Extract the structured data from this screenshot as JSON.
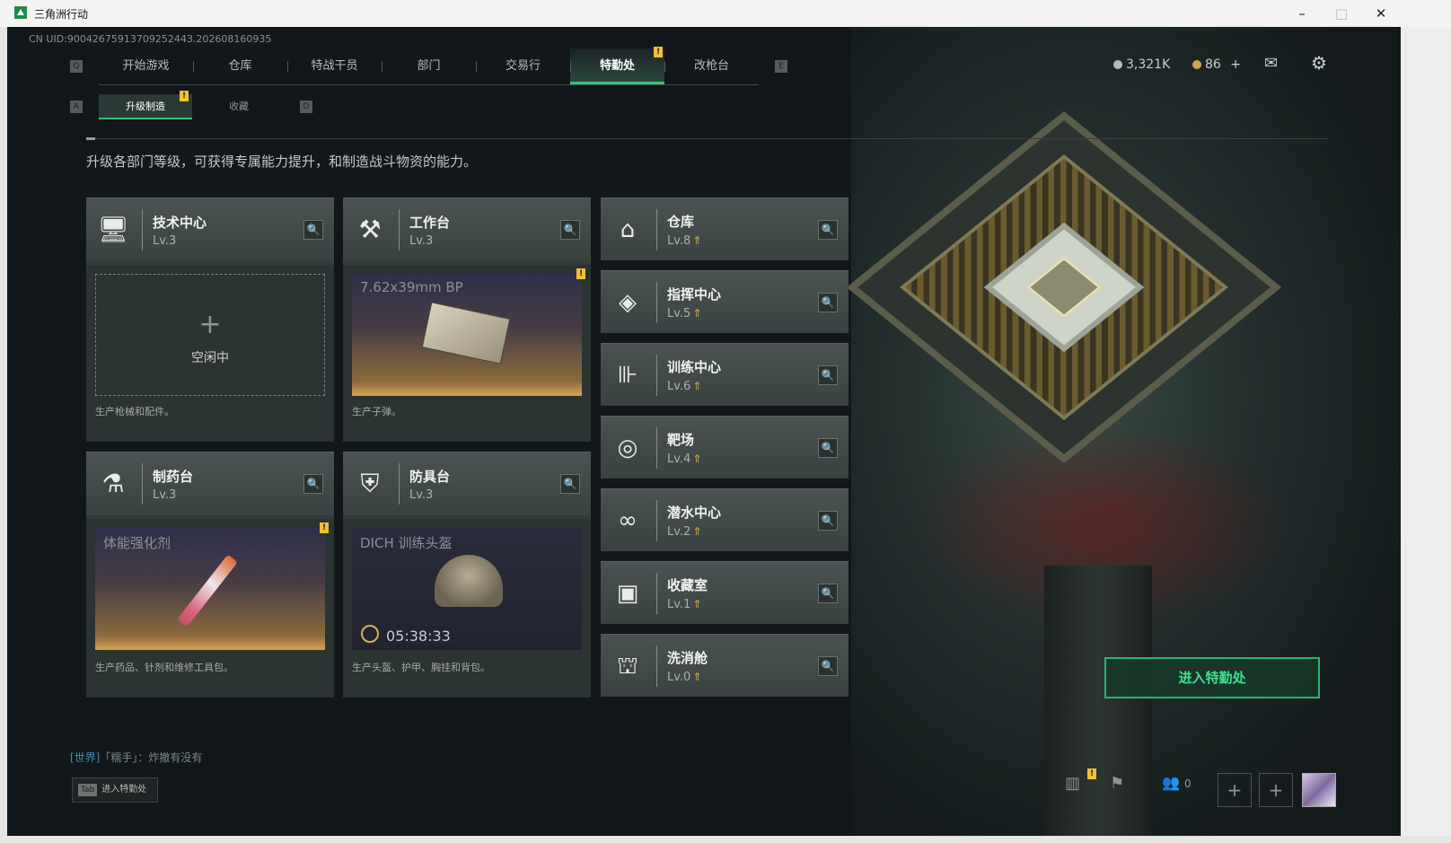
{
  "window": {
    "title": "三角洲行动",
    "controls": {
      "minimize": "–",
      "maximize": "□",
      "close": "✕"
    }
  },
  "uid": "CN UID:9004267591370925244З.202608160935",
  "nav": {
    "key_left": "Q",
    "key_right": "E",
    "tabs": [
      {
        "label": "开始游戏"
      },
      {
        "label": "仓库"
      },
      {
        "label": "特战干员"
      },
      {
        "label": "部门"
      },
      {
        "label": "交易行"
      },
      {
        "label": "特勤处",
        "active": true,
        "badge": "!"
      },
      {
        "label": "改枪台"
      }
    ]
  },
  "currency": {
    "value1": "3,321K",
    "value2": "86",
    "add": "+"
  },
  "icons": {
    "mail": "mail-icon",
    "settings": "gear-icon"
  },
  "subnav": {
    "key_left": "A",
    "key_right": "D",
    "tabs": [
      {
        "label": "升级制造",
        "active": true,
        "badge": "!"
      },
      {
        "label": "收藏"
      }
    ]
  },
  "intro": "升级各部门等级，可获得专属能力提升，和制造战斗物资的能力。",
  "stations": {
    "tech": {
      "name": "技术中心",
      "lv": "Lv.3",
      "slot_label": "空闲中",
      "slot_plus": "+",
      "desc": "生产枪械和配件。"
    },
    "workbench": {
      "name": "工作台",
      "lv": "Lv.3",
      "item": "7.62x39mm BP",
      "badge": "!",
      "desc": "生产子弹。"
    },
    "pharmacy": {
      "name": "制药台",
      "lv": "Lv.3",
      "item": "体能强化剂",
      "badge": "!",
      "desc": "生产药品、针剂和维修工具包。"
    },
    "armor": {
      "name": "防具台",
      "lv": "Lv.3",
      "item": "DICH 训练头盔",
      "timer": "05:38:33",
      "desc": "生产头盔、护甲、胸挂和背包。"
    }
  },
  "facilities": [
    {
      "name": "仓库",
      "lv": "Lv.8",
      "icon": "warehouse-icon"
    },
    {
      "name": "指挥中心",
      "lv": "Lv.5",
      "icon": "command-icon"
    },
    {
      "name": "训练中心",
      "lv": "Lv.6",
      "icon": "dumbbell-icon"
    },
    {
      "name": "靶场",
      "lv": "Lv.4",
      "icon": "target-icon"
    },
    {
      "name": "潜水中心",
      "lv": "Lv.2",
      "icon": "diving-mask-icon"
    },
    {
      "name": "收藏室",
      "lv": "Lv.1",
      "icon": "collection-icon"
    },
    {
      "name": "洗消舱",
      "lv": "Lv.0",
      "icon": "decontamination-icon"
    }
  ],
  "enter_button": "进入特勤处",
  "chat": {
    "channel": "[世界]",
    "user": "「糯手」",
    "message": "：炸撤有没有"
  },
  "tab_hint": {
    "key": "Tab",
    "label": "进入特勤处"
  },
  "bottom": {
    "friends_count": "0",
    "plus": "+"
  }
}
